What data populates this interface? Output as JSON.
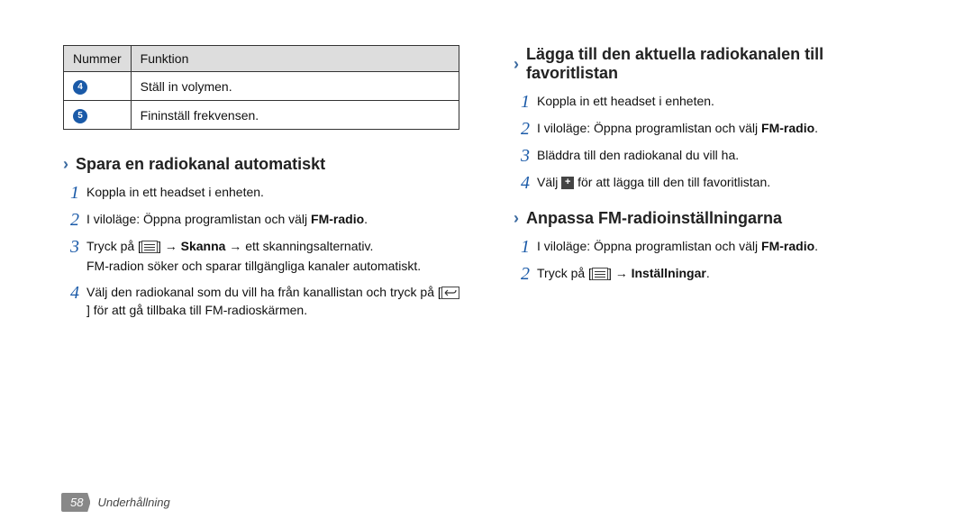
{
  "table": {
    "headers": {
      "num": "Nummer",
      "func": "Funktion"
    },
    "rows": [
      {
        "num": "4",
        "desc": "Ställ in volymen."
      },
      {
        "num": "5",
        "desc": "Fininställ frekvensen."
      }
    ]
  },
  "sections": {
    "left1": {
      "title": "Spara en radiokanal automatiskt",
      "steps": {
        "s1": "Koppla in ett headset i enheten.",
        "s2_a": "I viloläge: Öppna programlistan och välj ",
        "s2_b": "FM-radio",
        "s2_c": ".",
        "s3_a": "Tryck på [",
        "s3_b": "] → ",
        "s3_c": "Skanna",
        "s3_d": " → ett skanningsalternativ.",
        "s3_sub": "FM-radion söker och sparar tillgängliga kanaler automatiskt.",
        "s4_a": "Välj den radiokanal som du vill ha från kanallistan och tryck på [",
        "s4_b": "] för att gå tillbaka till FM-radioskärmen."
      }
    },
    "right1": {
      "title": "Lägga till den aktuella radiokanalen till favoritlistan",
      "steps": {
        "s1": "Koppla in ett headset i enheten.",
        "s2_a": "I viloläge: Öppna programlistan och välj ",
        "s2_b": "FM-radio",
        "s2_c": ".",
        "s3": "Bläddra till den radiokanal du vill ha.",
        "s4_a": "Välj ",
        "s4_b": " för att lägga till den till favoritlistan."
      }
    },
    "right2": {
      "title": "Anpassa FM-radioinställningarna",
      "steps": {
        "s1_a": "I viloläge: Öppna programlistan och välj ",
        "s1_b": "FM-radio",
        "s1_c": ".",
        "s2_a": "Tryck på [",
        "s2_b": "] → ",
        "s2_c": "Inställningar",
        "s2_d": "."
      }
    }
  },
  "footer": {
    "page": "58",
    "section": "Underhållning"
  },
  "glyphs": {
    "chevron": "›",
    "plus": "+",
    "back": "↶"
  }
}
